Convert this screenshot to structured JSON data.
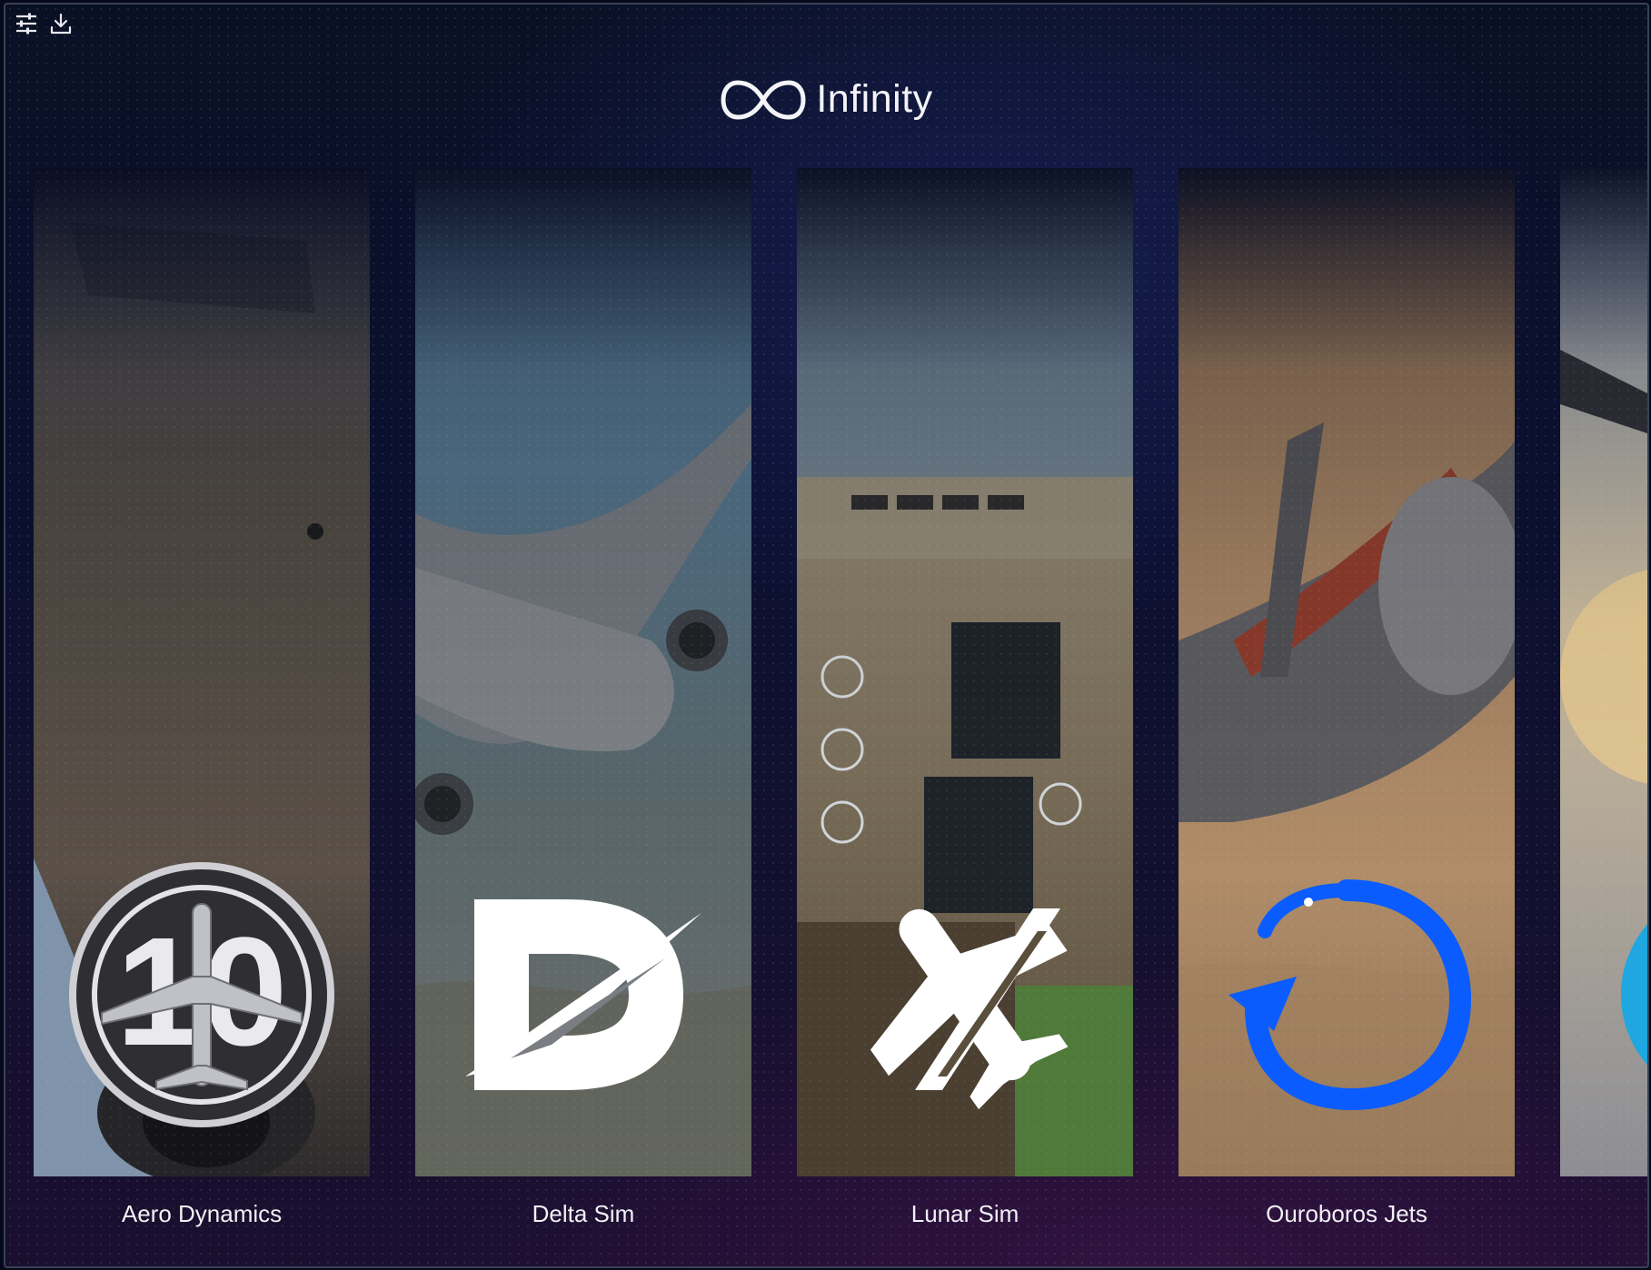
{
  "app": {
    "brand": "Infinity"
  },
  "toolbar": {
    "settings_icon": "sliders-icon",
    "download_icon": "download-icon"
  },
  "colors": {
    "accent_blue": "#0a5cff",
    "cyan": "#1ea7e0",
    "background": "#05091a"
  },
  "cards": [
    {
      "label": "Aero Dynamics",
      "logo_icon": "plane-patch-logo"
    },
    {
      "label": "Delta Sim",
      "logo_icon": "d-logo"
    },
    {
      "label": "Lunar Sim",
      "logo_icon": "plane-slash-logo"
    },
    {
      "label": "Ouroboros Jets",
      "logo_icon": "ouroboros-logo"
    },
    {
      "label": "",
      "logo_icon": "cyan-circle-logo"
    }
  ]
}
